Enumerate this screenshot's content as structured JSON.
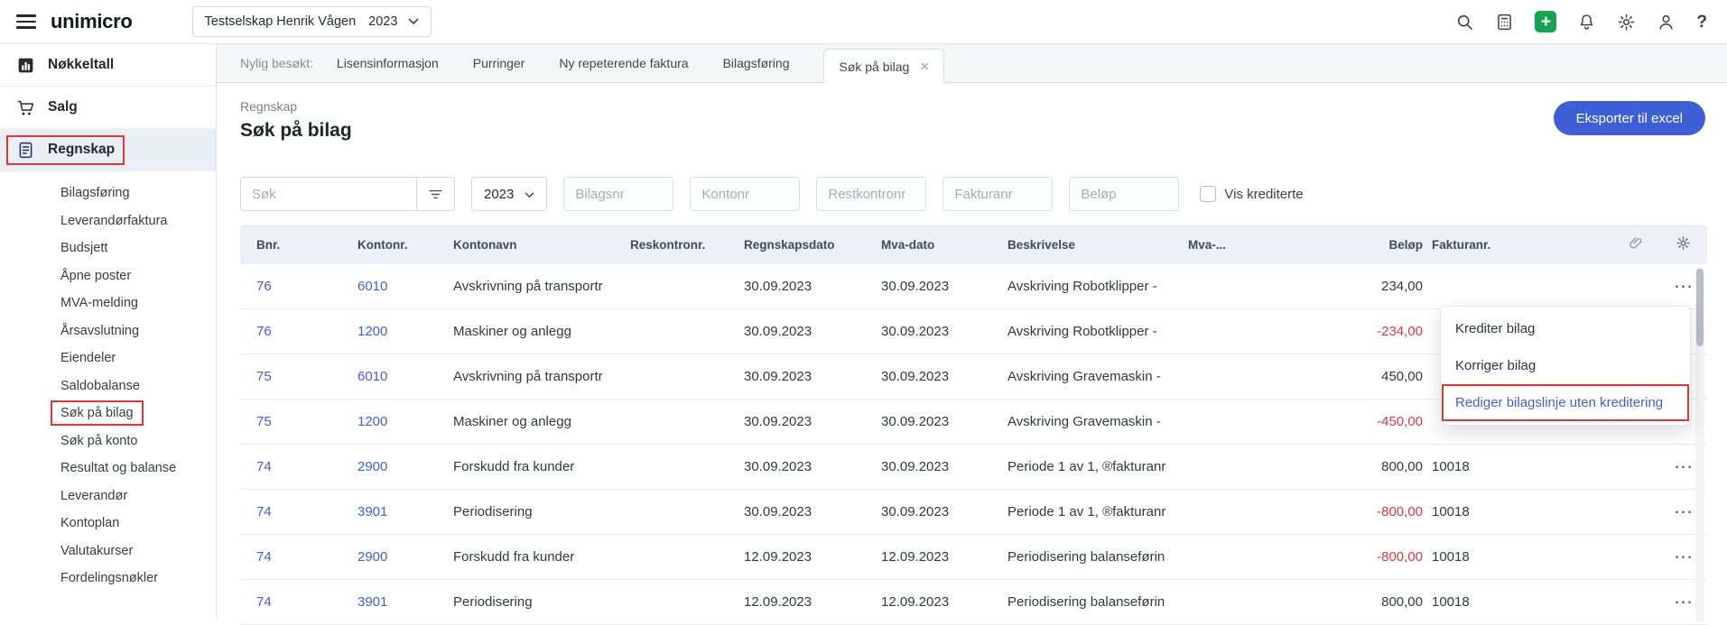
{
  "colors": {
    "accent": "#3e5fd6",
    "neg": "#d63b3b",
    "ann": "#e6342e",
    "green": "#17a24f"
  },
  "topbar": {
    "logo": "unimicro",
    "company_selector": {
      "company": "Testselskap Henrik Vågen",
      "year": "2023"
    },
    "icons": [
      {
        "name": "search-icon"
      },
      {
        "name": "calculator-icon"
      },
      {
        "name": "quick-add-icon"
      },
      {
        "name": "notifications-bell-icon"
      },
      {
        "name": "settings-gear-icon"
      },
      {
        "name": "user-profile-icon"
      },
      {
        "name": "help-icon"
      }
    ]
  },
  "tabs": {
    "recent_label": "Nylig besøkt:",
    "items": [
      {
        "label": "Lisensinformasjon",
        "active": false
      },
      {
        "label": "Purringer",
        "active": false
      },
      {
        "label": "Ny repeterende faktura",
        "active": false
      },
      {
        "label": "Bilagsføring",
        "active": false
      },
      {
        "label": "Søk på bilag",
        "active": true,
        "closable": true
      }
    ]
  },
  "sidebar": {
    "sections": [
      {
        "label": "Nøkkeltall",
        "icon": "bar-chart-icon",
        "active": false,
        "annotated": false
      },
      {
        "label": "Salg",
        "icon": "cart-icon",
        "active": false,
        "annotated": false
      },
      {
        "label": "Regnskap",
        "icon": "ledger-icon",
        "active": true,
        "annotated": true
      }
    ],
    "subitems": [
      {
        "label": "Bilagsføring",
        "annotated": false
      },
      {
        "label": "Leverandørfaktura",
        "annotated": false
      },
      {
        "label": "Budsjett",
        "annotated": false
      },
      {
        "label": "Åpne poster",
        "annotated": false
      },
      {
        "label": "MVA-melding",
        "annotated": false
      },
      {
        "label": "Årsavslutning",
        "annotated": false
      },
      {
        "label": "Eiendeler",
        "annotated": false
      },
      {
        "label": "Saldobalanse",
        "annotated": false
      },
      {
        "label": "Søk på bilag",
        "annotated": true
      },
      {
        "label": "Søk på konto",
        "annotated": false
      },
      {
        "label": "Resultat og balanse",
        "annotated": false
      },
      {
        "label": "Leverandør",
        "annotated": false
      },
      {
        "label": "Kontoplan",
        "annotated": false
      },
      {
        "label": "Valutakurser",
        "annotated": false
      },
      {
        "label": "Fordelingsnøkler",
        "annotated": false
      }
    ]
  },
  "page": {
    "breadcrumb": "Regnskap",
    "title": "Søk på bilag",
    "export_button": "Eksporter til excel"
  },
  "filters": {
    "search_placeholder": "Søk",
    "year": "2023",
    "inputs": [
      "Bilagsnr",
      "Kontonr",
      "Restkontronr",
      "Fakturanr",
      "Beløp"
    ],
    "checkbox_label": "Vis krediterte",
    "checkbox_checked": false
  },
  "table": {
    "headers": [
      "Bnr.",
      "Kontonr.",
      "Kontonavn",
      "Reskontronr.",
      "Regnskapsdato",
      "Mva-dato",
      "Beskrivelse",
      "Mva-...",
      "Beløp",
      "Fakturanr."
    ],
    "rows": [
      {
        "bnr": "76",
        "kontonr": "6010",
        "kontonavn": "Avskrivning på transportr",
        "reskontronr": "",
        "regnskapsdato": "30.09.2023",
        "mva_dato": "30.09.2023",
        "beskrivelse": "Avskriving Robotklipper -",
        "mva": "",
        "belop": "234,00",
        "fakturanr": ""
      },
      {
        "bnr": "76",
        "kontonr": "1200",
        "kontonavn": "Maskiner og anlegg",
        "reskontronr": "",
        "regnskapsdato": "30.09.2023",
        "mva_dato": "30.09.2023",
        "beskrivelse": "Avskriving Robotklipper -",
        "mva": "",
        "belop": "-234,00",
        "fakturanr": ""
      },
      {
        "bnr": "75",
        "kontonr": "6010",
        "kontonavn": "Avskrivning på transportr",
        "reskontronr": "",
        "regnskapsdato": "30.09.2023",
        "mva_dato": "30.09.2023",
        "beskrivelse": "Avskriving Gravemaskin -",
        "mva": "",
        "belop": "450,00",
        "fakturanr": ""
      },
      {
        "bnr": "75",
        "kontonr": "1200",
        "kontonavn": "Maskiner og anlegg",
        "reskontronr": "",
        "regnskapsdato": "30.09.2023",
        "mva_dato": "30.09.2023",
        "beskrivelse": "Avskriving Gravemaskin -",
        "mva": "",
        "belop": "-450,00",
        "fakturanr": ""
      },
      {
        "bnr": "74",
        "kontonr": "2900",
        "kontonavn": "Forskudd fra kunder",
        "reskontronr": "",
        "regnskapsdato": "30.09.2023",
        "mva_dato": "30.09.2023",
        "beskrivelse": "Periode 1 av 1, ®fakturanr",
        "mva": "",
        "belop": "800,00",
        "fakturanr": "10018"
      },
      {
        "bnr": "74",
        "kontonr": "3901",
        "kontonavn": "Periodisering",
        "reskontronr": "",
        "regnskapsdato": "30.09.2023",
        "mva_dato": "30.09.2023",
        "beskrivelse": "Periode 1 av 1, ®fakturanr",
        "mva": "",
        "belop": "-800,00",
        "fakturanr": "10018"
      },
      {
        "bnr": "74",
        "kontonr": "2900",
        "kontonavn": "Forskudd fra kunder",
        "reskontronr": "",
        "regnskapsdato": "12.09.2023",
        "mva_dato": "12.09.2023",
        "beskrivelse": "Periodisering balanseførin",
        "mva": "",
        "belop": "-800,00",
        "fakturanr": "10018"
      },
      {
        "bnr": "74",
        "kontonr": "3901",
        "kontonavn": "Periodisering",
        "reskontronr": "",
        "regnskapsdato": "12.09.2023",
        "mva_dato": "12.09.2023",
        "beskrivelse": "Periodisering balanseførin",
        "mva": "",
        "belop": "800,00",
        "fakturanr": "10018"
      }
    ]
  },
  "context_menu": {
    "items": [
      {
        "label": "Krediter bilag",
        "highlighted": false
      },
      {
        "label": "Korriger bilag",
        "highlighted": false
      },
      {
        "label": "Rediger bilagslinje uten kreditering",
        "highlighted": true
      }
    ]
  }
}
